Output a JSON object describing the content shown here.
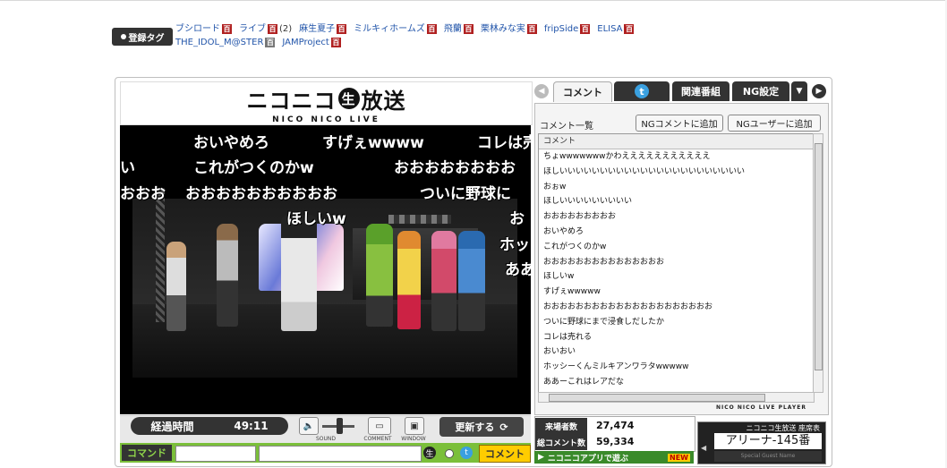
{
  "tags": {
    "label": "登録タグ",
    "line1": [
      {
        "text": "ブシロード",
        "count": ""
      },
      {
        "text": "ライブ",
        "count": "(2)"
      },
      {
        "text": "麻生夏子",
        "count": ""
      },
      {
        "text": "ミルキィホームズ",
        "count": ""
      },
      {
        "text": "飛蘭",
        "count": ""
      },
      {
        "text": "栗林みな実",
        "count": ""
      },
      {
        "text": "fripSide",
        "count": ""
      },
      {
        "text": "ELISA",
        "count": ""
      }
    ],
    "line2": [
      {
        "text": "THE_IDOL_M@STER",
        "count": ""
      },
      {
        "text": "JAMProject",
        "count": ""
      }
    ],
    "dic_glyph": "百"
  },
  "logo": {
    "main_left": "ニコニコ",
    "main_circle": "生",
    "main_right": "放送",
    "sub": "NICO NICO LIVE"
  },
  "overlay_comments": [
    "おいやめろ",
    "すげぇwwww",
    "コレは売",
    "い",
    "これがつくのかw",
    "おおおおおおおお",
    "おおお",
    "おおおおおおおおおお",
    "ついに野球に",
    "ほしいw",
    "お",
    "ホッ",
    "ああ"
  ],
  "controls": {
    "elapsed_label": "経過時間",
    "elapsed_value": "49:11",
    "sound_label": "SOUND",
    "comment_label": "COMMENT",
    "window_label": "WINDOW",
    "refresh_label": "更新する",
    "command_label": "コマンド",
    "send_label": "コメント"
  },
  "tabs": {
    "comment": "コメント",
    "related": "関連番組",
    "ng": "NG設定"
  },
  "panel": {
    "heading": "コメント一覧",
    "ng_comment_btn": "NGコメントに追加",
    "ng_user_btn": "NGユーザーに追加",
    "list_header": "コメント",
    "rows": [
      "ちょwwwwwwwかわえええええええええええ",
      "ほしいいいいいいいいいいいいいいいいいいいいいいい",
      "おぉw",
      "ほしいいいいいいいいい",
      "おおおおおおおおお",
      "おいやめろ",
      "これがつくのかw",
      "おおおおおおおおおおおおおおお",
      "ほしいw",
      "すげぇwwwww",
      "おおおおおおおおおおおおおおおおおおおおお",
      "ついに野球にまで浸食しだしたか",
      "コレは売れる",
      "おいおい",
      "ホッシーくんミルキアンワラタwwwww",
      "ああーこれはレアだな"
    ],
    "brand": "NICO NICO LIVE PLAYER"
  },
  "stats": {
    "visitors_label": "来場者数",
    "visitors_value": "27,474",
    "comments_label": "総コメント数",
    "comments_value": "59,334"
  },
  "app_bar": {
    "text": "ニコニコアプリで遊ぶ",
    "badge": "NEW"
  },
  "seat": {
    "title": "ニコニコ生放送 座席表",
    "value": "アリーナ-145番",
    "footer": "Special Guest Name"
  },
  "colors": {
    "accent_green": "#7bbf3a",
    "send_yellow": "#ffcc00",
    "link_blue": "#2255aa",
    "dic_red": "#b02020"
  }
}
